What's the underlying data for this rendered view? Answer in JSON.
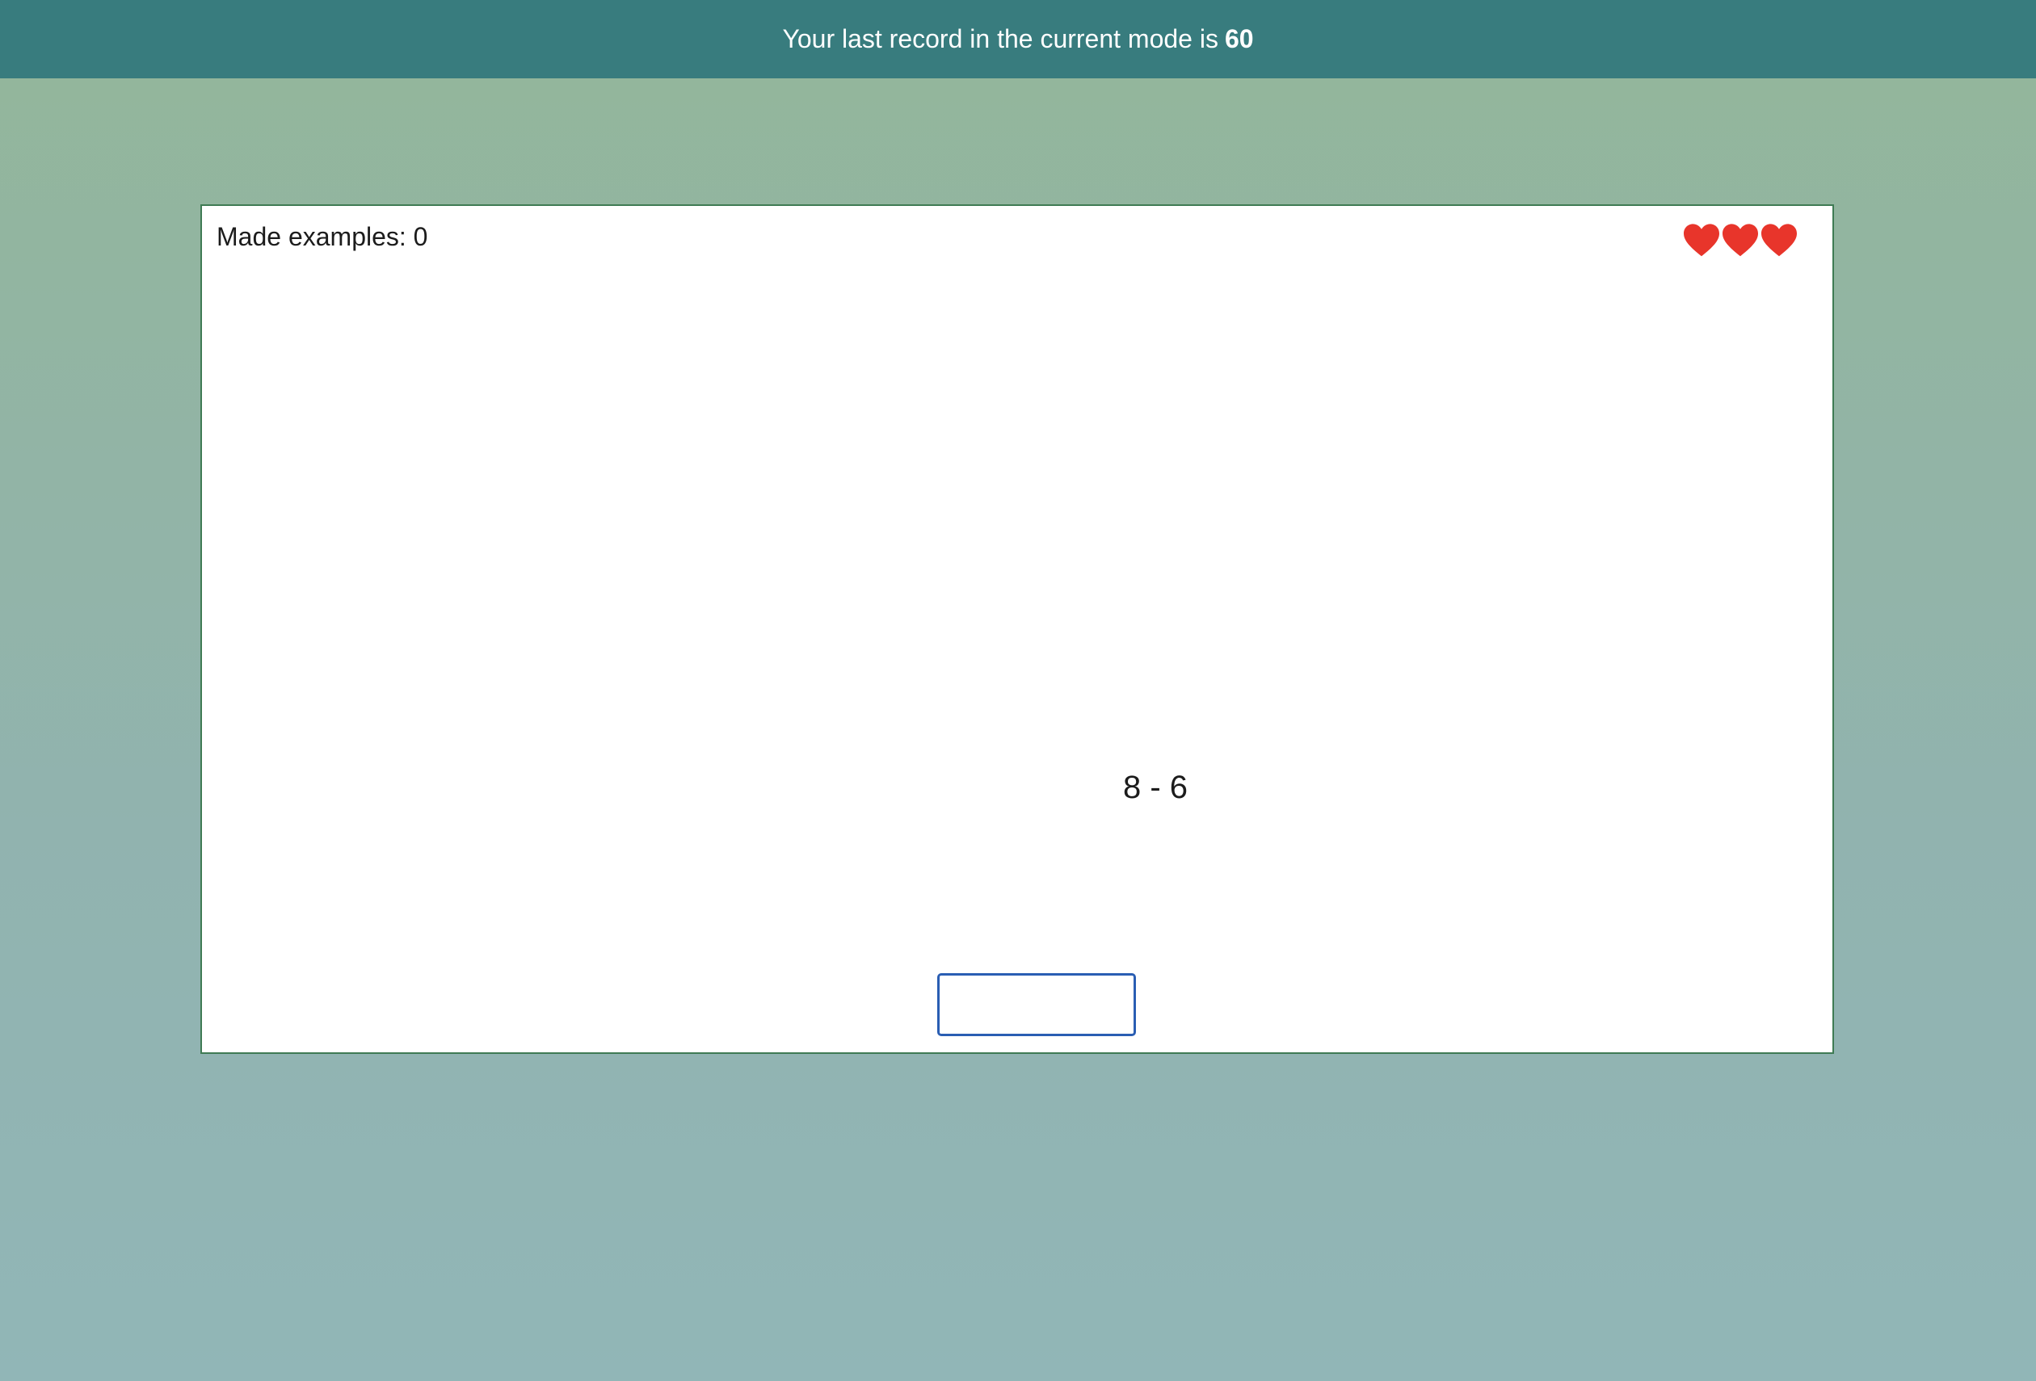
{
  "banner": {
    "text": "Your last record in the current mode is",
    "record": "60"
  },
  "game": {
    "made_examples_label": "Made examples: 0",
    "lives": 3,
    "heart_color": "#e8352b",
    "expression": "8 - 6",
    "answer_value": ""
  }
}
